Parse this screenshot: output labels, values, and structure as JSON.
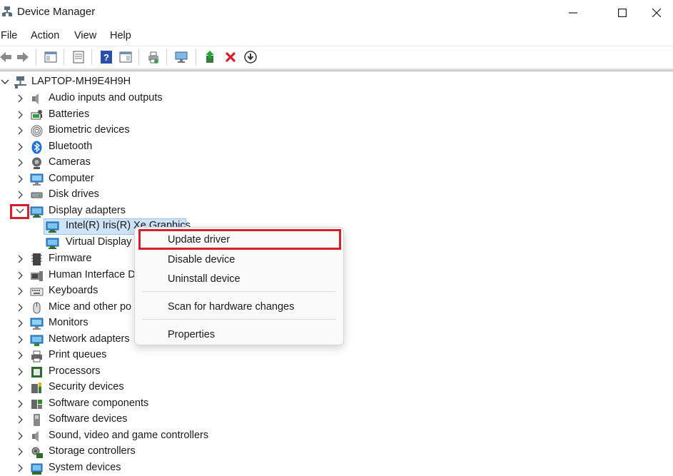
{
  "window": {
    "title": "Device Manager",
    "computer_name": "LAPTOP-MH9E4H9H"
  },
  "menu": [
    "File",
    "Action",
    "View",
    "Help"
  ],
  "toolbar": {
    "icons": [
      "back-icon",
      "forward-icon",
      "show-hide-tree-icon",
      "properties-icon",
      "help-icon",
      "view-icon",
      "print-icon",
      "scan-hardware-icon",
      "update-driver-icon",
      "uninstall-icon",
      "rollback-icon"
    ]
  },
  "tree": {
    "categories": [
      "Audio inputs and outputs",
      "Batteries",
      "Biometric devices",
      "Bluetooth",
      "Cameras",
      "Computer",
      "Disk drives",
      "Display adapters",
      "Firmware",
      "Human Interface D",
      "Keyboards",
      "Mice and other po",
      "Monitors",
      "Network adapters",
      "Print queues",
      "Processors",
      "Security devices",
      "Software components",
      "Software devices",
      "Sound, video and game controllers",
      "Storage controllers",
      "System devices"
    ],
    "display_children": [
      "Intel(R) Iris(R) Xe Graphics",
      "Virtual Display"
    ]
  },
  "context_menu": {
    "update": "Update driver",
    "disable": "Disable device",
    "uninstall": "Uninstall device",
    "scan": "Scan for hardware changes",
    "properties": "Properties"
  },
  "colors": {
    "highlight_red": "#d3202e",
    "selection": "#cde3f7"
  }
}
